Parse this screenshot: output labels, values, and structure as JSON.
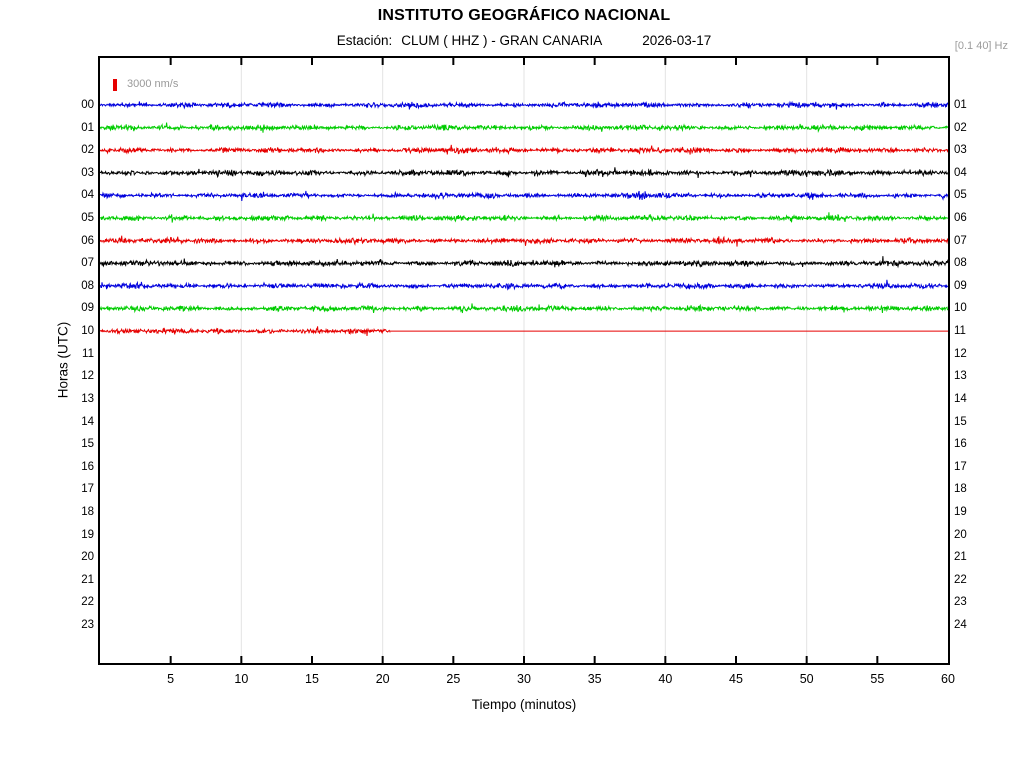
{
  "header": {
    "title": "INSTITUTO GEOGRÁFICO NACIONAL",
    "station_label": "Estación:",
    "station": "CLUM ( HHZ ) - GRAN CANARIA",
    "date": "2026-03-17",
    "filter": "[0.1 40] Hz"
  },
  "legend": {
    "label": "3000 nm/s",
    "marker_color": "#e60000"
  },
  "axes": {
    "ylabel": "Horas (UTC)",
    "xlabel": "Tiempo (minutos)",
    "x_ticks": [
      5,
      10,
      15,
      20,
      25,
      30,
      35,
      40,
      45,
      50,
      55,
      60
    ],
    "left_hour_labels": [
      "00",
      "01",
      "02",
      "03",
      "04",
      "05",
      "06",
      "07",
      "08",
      "09",
      "10",
      "11",
      "12",
      "13",
      "14",
      "15",
      "16",
      "17",
      "18",
      "19",
      "20",
      "21",
      "22",
      "23"
    ],
    "right_hour_labels": [
      "01",
      "02",
      "03",
      "04",
      "05",
      "06",
      "07",
      "08",
      "09",
      "10",
      "11",
      "12",
      "13",
      "14",
      "15",
      "16",
      "17",
      "18",
      "19",
      "20",
      "21",
      "22",
      "23",
      "24"
    ]
  },
  "chart_data": {
    "type": "line",
    "subtype": "helicorder-seismogram",
    "title": "INSTITUTO GEOGRÁFICO NACIONAL",
    "subtitle": "Estación: CLUM ( HHZ ) - GRAN CANARIA 2026-03-17",
    "xlabel": "Tiempo (minutos)",
    "ylabel": "Horas (UTC)",
    "x_range_minutes": [
      0,
      60
    ],
    "rows_total": 24,
    "grid": "vertical lines every 10 minutes",
    "grid_minutes": [
      10,
      20,
      30,
      40,
      50
    ],
    "grid_color": "#e3e3e3",
    "tick_minutes": [
      5,
      10,
      15,
      20,
      25,
      30,
      35,
      40,
      45,
      50,
      55
    ],
    "color_cycle": [
      "#0000dd",
      "#00cc00",
      "#e60000",
      "#000000"
    ],
    "scale_bar": {
      "label": "3000 nm/s",
      "color": "#e60000"
    },
    "traces": [
      {
        "row": 0,
        "hour": "00",
        "color": "#0000dd",
        "start_min": 0,
        "end_min": 60,
        "amplitude": 2.2,
        "events": []
      },
      {
        "row": 1,
        "hour": "01",
        "color": "#00cc00",
        "start_min": 0,
        "end_min": 60,
        "amplitude": 2.4,
        "events": []
      },
      {
        "row": 2,
        "hour": "02",
        "color": "#e60000",
        "start_min": 0,
        "end_min": 60,
        "amplitude": 2.3,
        "events": []
      },
      {
        "row": 3,
        "hour": "03",
        "color": "#000000",
        "start_min": 0,
        "end_min": 60,
        "amplitude": 2.5,
        "events": []
      },
      {
        "row": 4,
        "hour": "04",
        "color": "#0000dd",
        "start_min": 0,
        "end_min": 60,
        "amplitude": 2.2,
        "events": [
          {
            "minute": 37.8,
            "peak": 2.6,
            "duration": 1.8
          }
        ]
      },
      {
        "row": 5,
        "hour": "05",
        "color": "#00cc00",
        "start_min": 0,
        "end_min": 60,
        "amplitude": 2.4,
        "events": []
      },
      {
        "row": 6,
        "hour": "06",
        "color": "#e60000",
        "start_min": 0,
        "end_min": 60,
        "amplitude": 2.3,
        "events": []
      },
      {
        "row": 7,
        "hour": "07",
        "color": "#000000",
        "start_min": 0,
        "end_min": 60,
        "amplitude": 2.4,
        "events": []
      },
      {
        "row": 8,
        "hour": "08",
        "color": "#0000dd",
        "start_min": 0,
        "end_min": 60,
        "amplitude": 2.2,
        "events": []
      },
      {
        "row": 9,
        "hour": "09",
        "color": "#00cc00",
        "start_min": 0,
        "end_min": 60,
        "amplitude": 2.3,
        "events": []
      },
      {
        "row": 10,
        "hour": "10",
        "color": "#e60000",
        "start_min": 0,
        "end_min": 20.5,
        "flat_to_min": 60,
        "amplitude": 2.1,
        "events": [
          {
            "minute": 6.3,
            "peak": 1.3,
            "duration": 1.2
          }
        ]
      }
    ]
  }
}
